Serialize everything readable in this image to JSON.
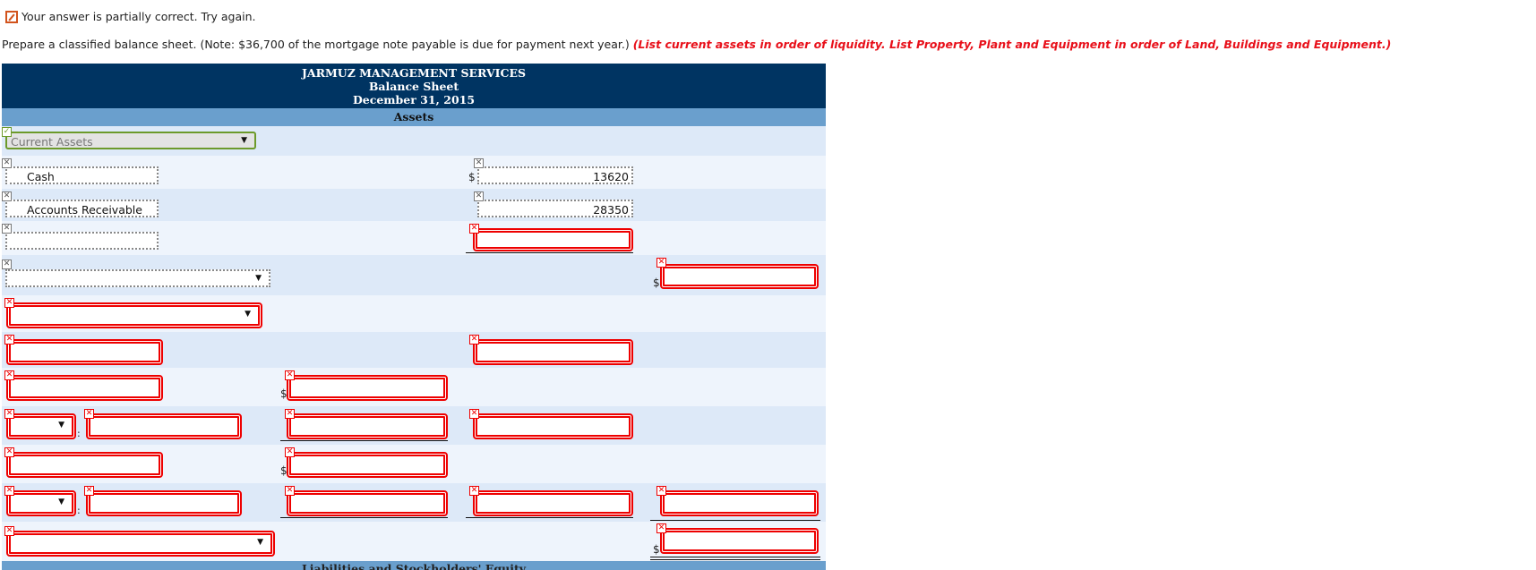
{
  "status": {
    "icon": "pencil-edit-icon",
    "message": "Your answer is partially correct.  Try again."
  },
  "prompt": {
    "text": "Prepare a classified balance sheet. (Note: $36,700 of the mortgage note payable is due for payment next year.) ",
    "hint": "(List current assets in order of liquidity. List Property, Plant and Equipment in order of Land, Buildings and Equipment.)"
  },
  "sheet": {
    "company": "JARMUZ MANAGEMENT SERVICES",
    "title": "Balance Sheet",
    "date": "December 31, 2015",
    "section": "Assets",
    "next_section": "Liabilities and Stockholders' Equity",
    "currency": "$",
    "heading_select": "Current Assets",
    "rows": [
      {
        "label": "Cash",
        "amount": "13620"
      },
      {
        "label": "Accounts Receivable",
        "amount": "28350"
      }
    ],
    "status_colors": {
      "correct": "#6c9a2a",
      "incorrect": "#e00000",
      "unchecked": "#777777"
    }
  }
}
